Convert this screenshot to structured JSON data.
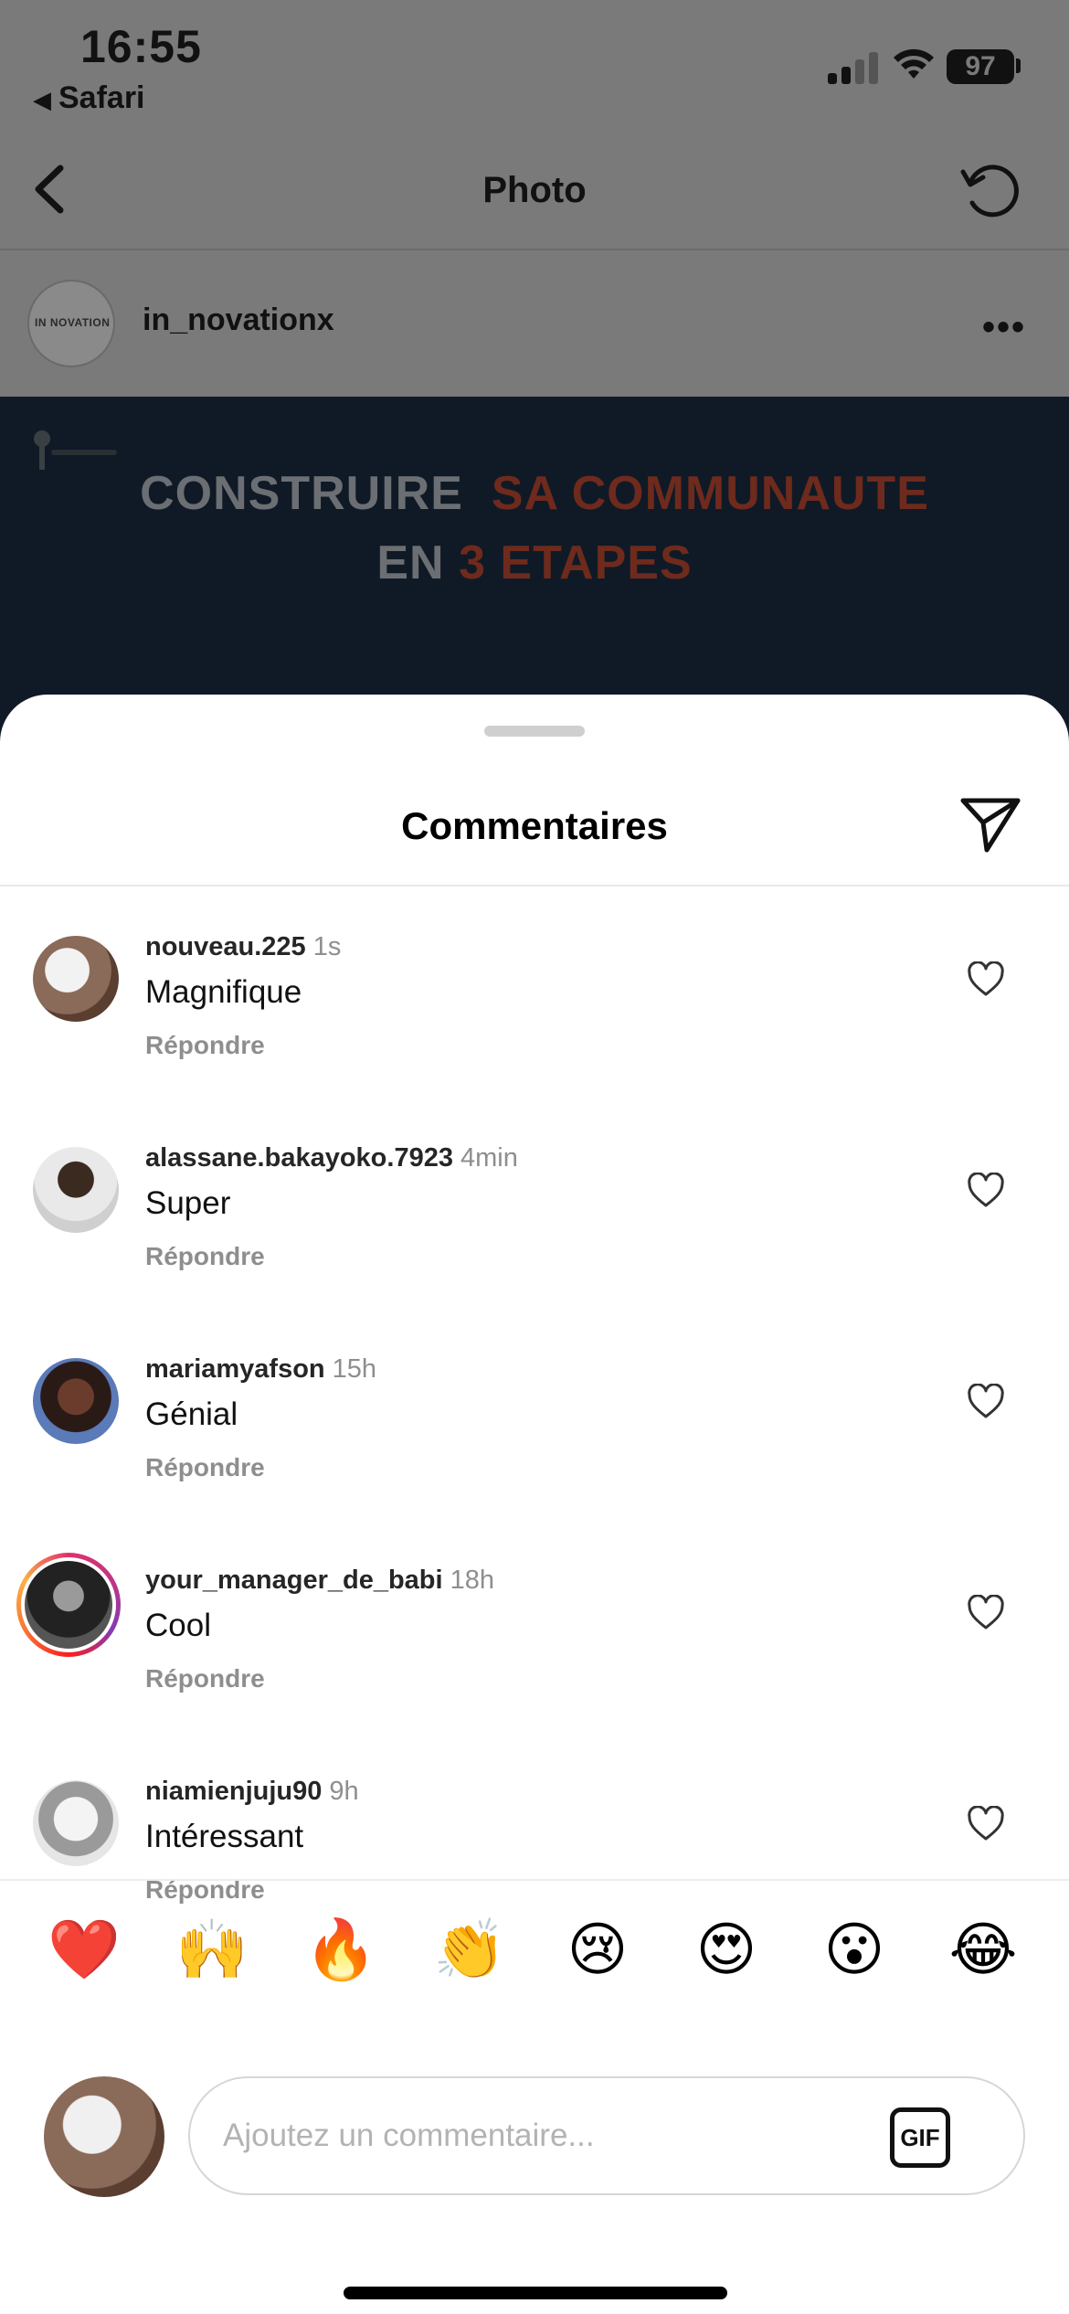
{
  "status_bar": {
    "time": "16:55",
    "back_app": "Safari",
    "battery": "97"
  },
  "nav": {
    "title": "Photo"
  },
  "post_author": {
    "username": "in_novationx",
    "avatar_text": "IN NOVATION"
  },
  "post_image": {
    "line1_a": "CONSTRUIRE",
    "line1_b": "SA COMMUNAUTE",
    "line2_a": "EN",
    "line2_b": "3 ETAPES"
  },
  "comments_sheet": {
    "title": "Commentaires",
    "reply_label": "Répondre",
    "comments": [
      {
        "username": "nouveau.225",
        "time": "1s",
        "text": "Magnifique"
      },
      {
        "username": "alassane.bakayoko.7923",
        "time": "4min",
        "text": "Super"
      },
      {
        "username": "mariamyafson",
        "time": "15h",
        "text": "Génial"
      },
      {
        "username": "your_manager_de_babi",
        "time": "18h",
        "text": "Cool"
      },
      {
        "username": "niamienjuju90",
        "time": "9h",
        "text": "Intéressant"
      }
    ],
    "quick_emojis": [
      "❤️",
      "🙌",
      "🔥",
      "👏",
      "😢",
      "😍",
      "😮",
      "😂"
    ]
  },
  "composer": {
    "placeholder": "Ajoutez un commentaire...",
    "gif_label": "GIF"
  }
}
